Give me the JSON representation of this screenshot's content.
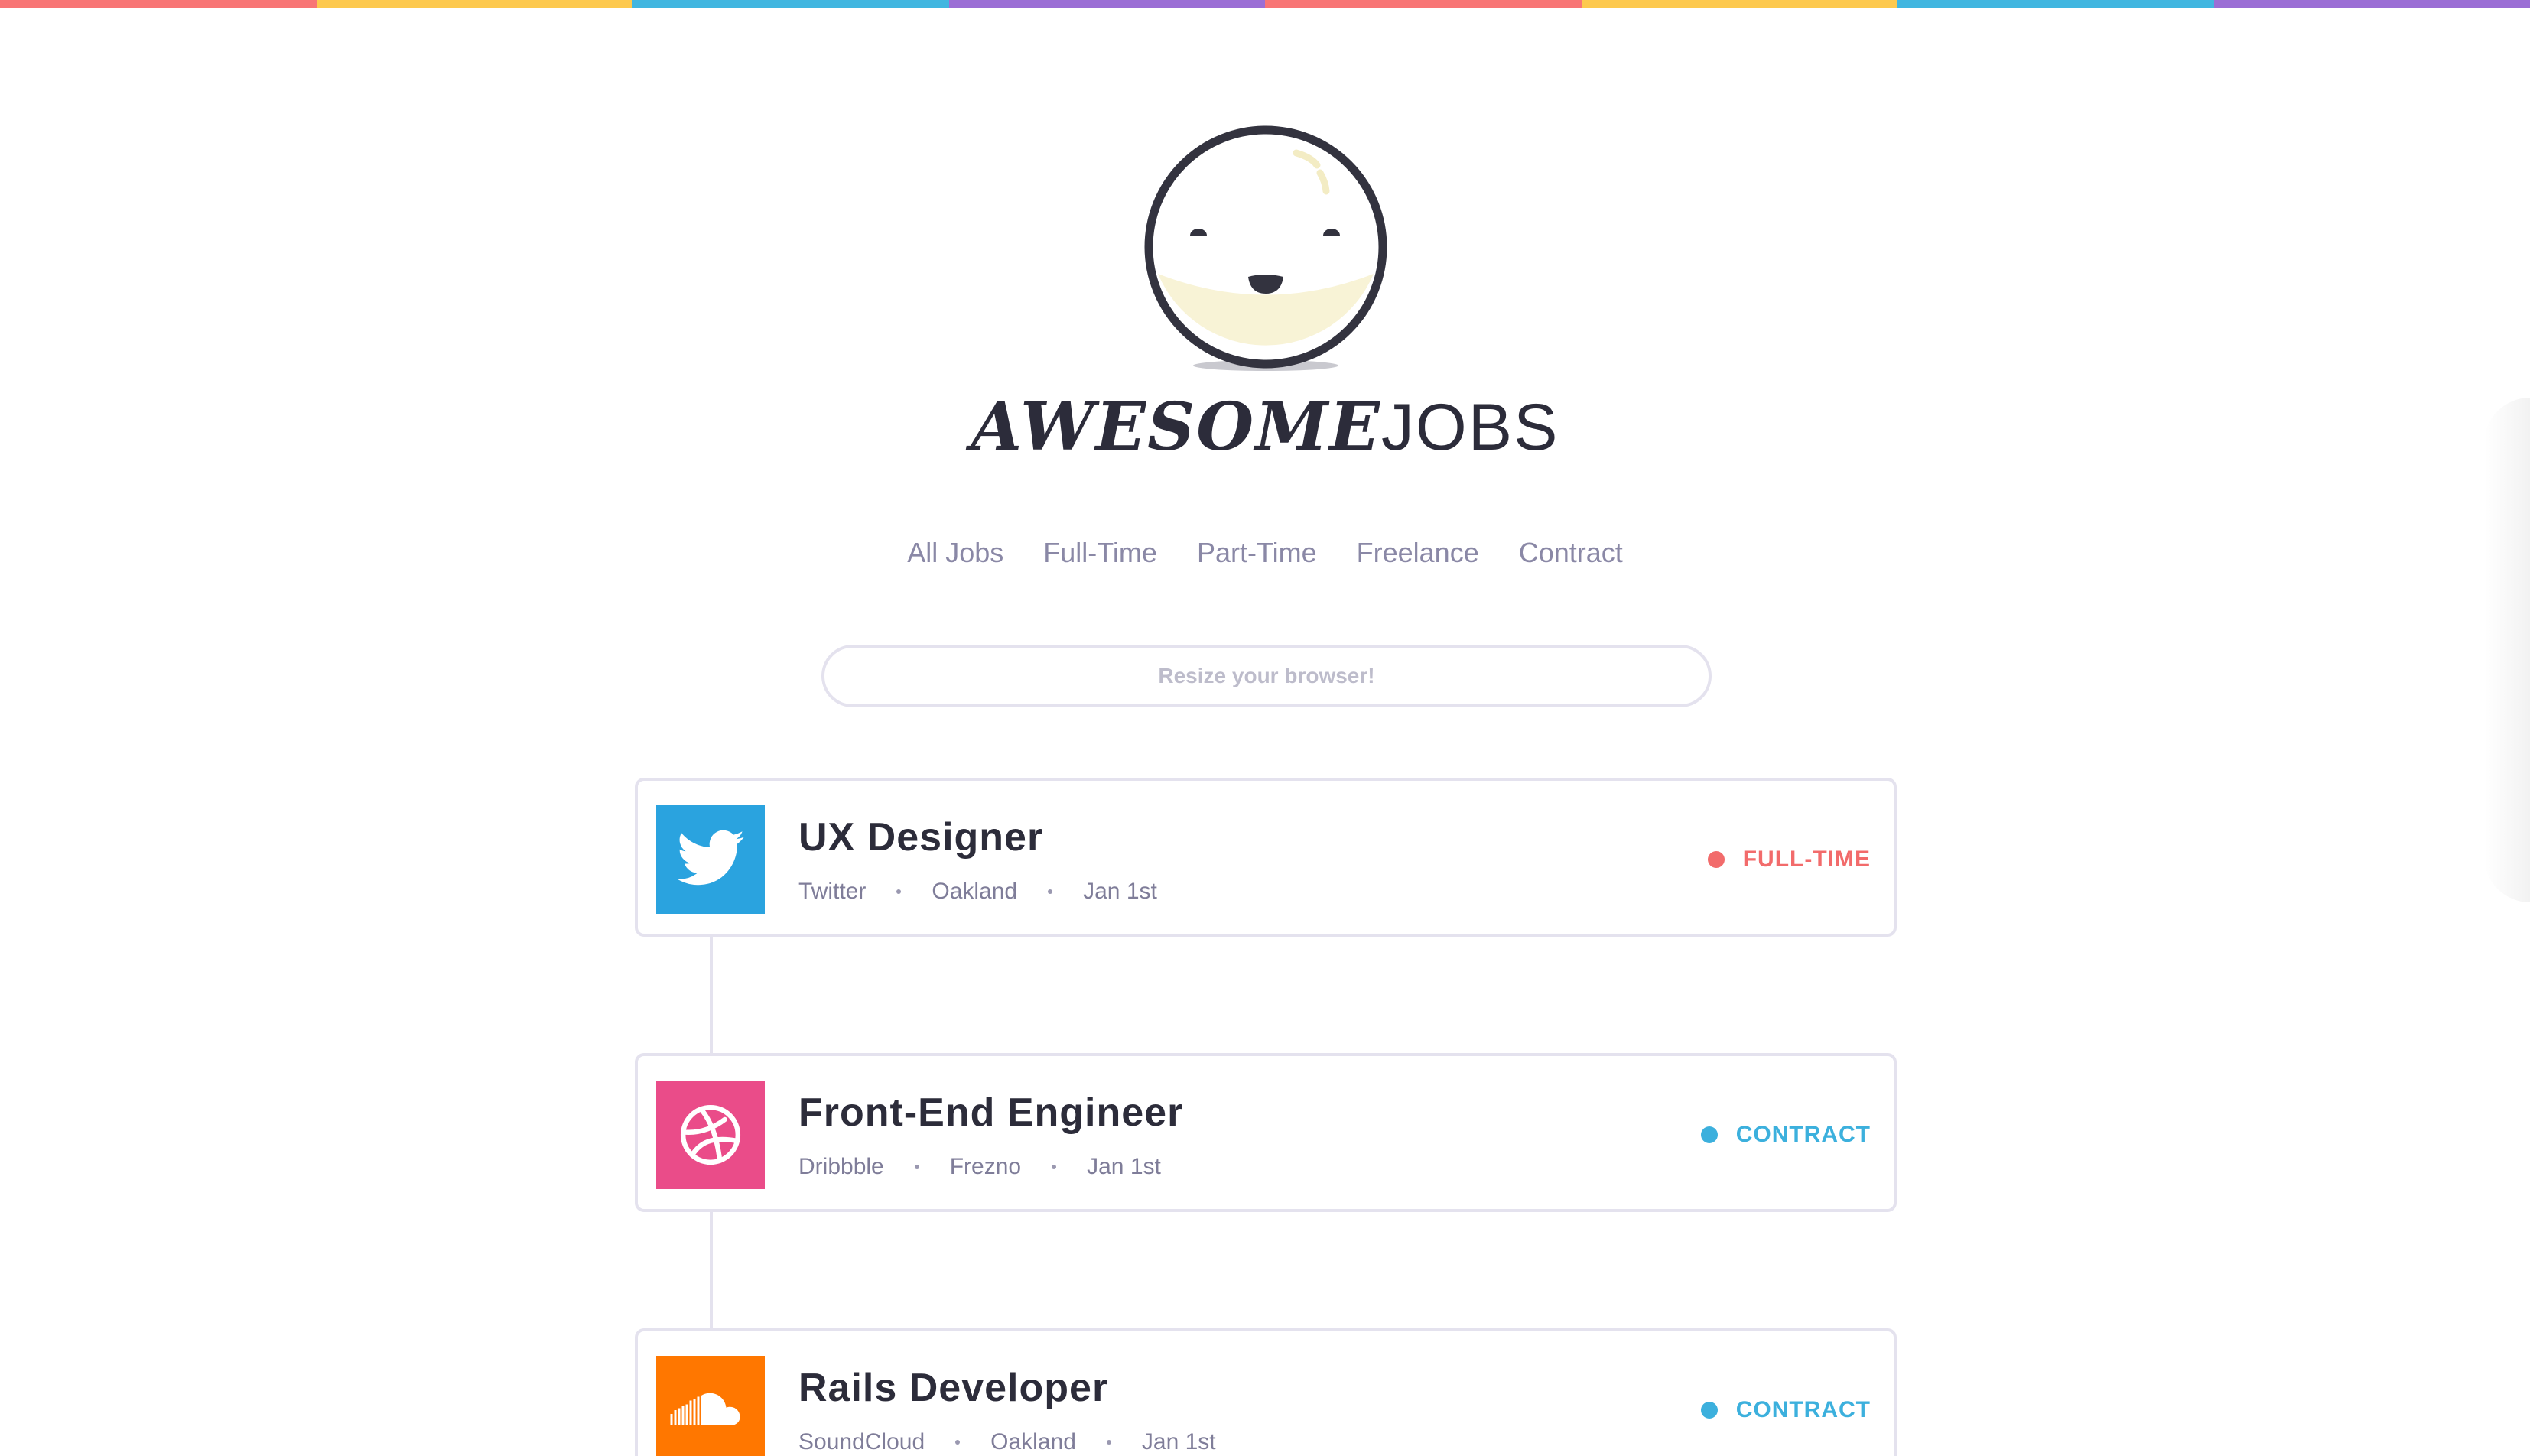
{
  "brand": {
    "part1": "AWESOME",
    "part2": "JOBS"
  },
  "rainbow_colors": [
    "#f87575",
    "#fdc94e",
    "#41b6e0",
    "#9b6ed5",
    "#f87575",
    "#fdc94e",
    "#41b6e0",
    "#9b6ed5"
  ],
  "nav": {
    "items": [
      "All Jobs",
      "Full-Time",
      "Part-Time",
      "Freelance",
      "Contract"
    ]
  },
  "search": {
    "placeholder": "Resize your browser!",
    "value": ""
  },
  "jobs": [
    {
      "title": "UX Designer",
      "company": "Twitter",
      "location": "Oakland",
      "date": "Jan 1st",
      "type": "FULL-TIME",
      "type_color": "#f26b6b",
      "logo_icon": "twitter-bird-icon",
      "logo_color": "#2aa3df"
    },
    {
      "title": "Front-End Engineer",
      "company": "Dribbble",
      "location": "Frezno",
      "date": "Jan 1st",
      "type": "CONTRACT",
      "type_color": "#3cb0dd",
      "logo_icon": "dribbble-ball-icon",
      "logo_color": "#ea4c89"
    },
    {
      "title": "Rails Developer",
      "company": "SoundCloud",
      "location": "Oakland",
      "date": "Jan 1st",
      "type": "CONTRACT",
      "type_color": "#3cb0dd",
      "logo_icon": "soundcloud-cloud-icon",
      "logo_color": "#ff7700"
    }
  ]
}
